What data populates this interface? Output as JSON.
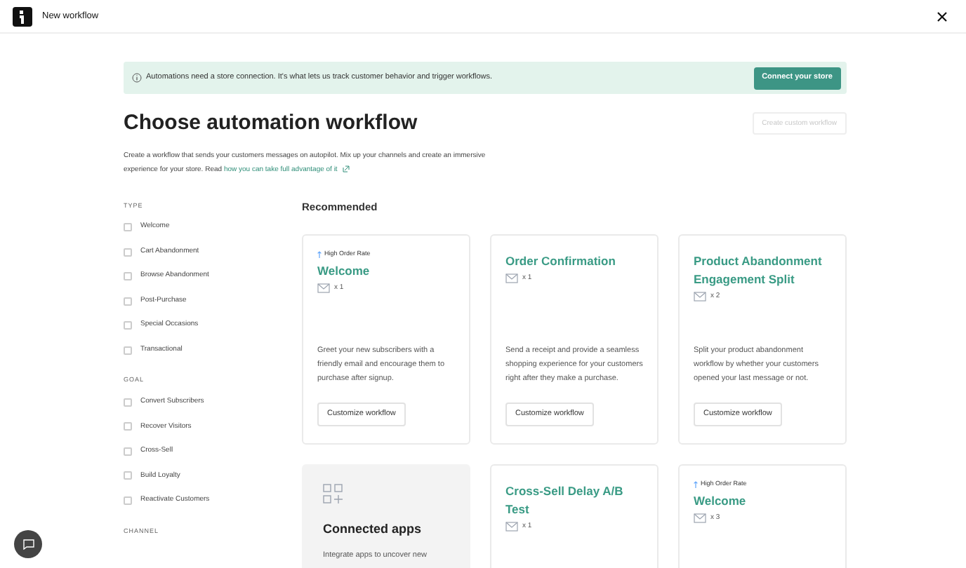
{
  "window": {
    "title": "New workflow"
  },
  "banner": {
    "text": "Automations need a store connection. It's what lets us track customer behavior and trigger workflows.",
    "button": "Connect your store"
  },
  "heading": "Choose automation workflow",
  "custom_button": {
    "label": "Create custom workflow",
    "disabled": true
  },
  "description": {
    "text": "Create a workflow that sends your customers messages on autopilot. Mix up your channels and create an immersive experience for your store. Read",
    "link": "how you can take full advantage of it"
  },
  "filters": [
    {
      "title": "TYPE",
      "items": [
        {
          "label": "Welcome",
          "checked": false
        },
        {
          "label": "Cart Abandonment",
          "checked": false
        },
        {
          "label": "Browse Abandonment",
          "checked": false
        },
        {
          "label": "Post-Purchase",
          "checked": false
        },
        {
          "label": "Special Occasions",
          "checked": false
        },
        {
          "label": "Transactional",
          "checked": false
        }
      ]
    },
    {
      "title": "GOAL",
      "items": [
        {
          "label": "Convert Subscribers",
          "checked": false
        },
        {
          "label": "Recover Visitors",
          "checked": false
        },
        {
          "label": "Cross-Sell",
          "checked": false
        },
        {
          "label": "Build Loyalty",
          "checked": false
        },
        {
          "label": "Reactivate Customers",
          "checked": false
        }
      ]
    },
    {
      "title": "CHANNEL"
    }
  ],
  "section_title": "Recommended",
  "cards": [
    {
      "kind": "workflow",
      "badge": "High Order Rate",
      "title": "Welcome",
      "count": "x 1",
      "description": "Greet your new subscribers with a friendly email and encourage them to purchase after signup.",
      "button": "Customize workflow"
    },
    {
      "kind": "workflow",
      "title": "Order Confirmation",
      "count": "x 1",
      "description": "Send a receipt and provide a seamless shopping experience for your customers right after they make a purchase.",
      "button": "Customize workflow"
    },
    {
      "kind": "workflow",
      "title": "Product Abandonment Engagement Split",
      "count": "x 2",
      "description": "Split your product abandonment workflow by whether your customers opened your last message or not.",
      "button": "Customize workflow"
    },
    {
      "kind": "apps",
      "title": "Connected apps",
      "description": "Integrate apps to uncover new"
    },
    {
      "kind": "workflow",
      "title": "Cross-Sell Delay A/B Test",
      "count": "x 1"
    },
    {
      "kind": "workflow",
      "badge": "High Order Rate",
      "title": "Welcome",
      "count": "x 3"
    }
  ]
}
